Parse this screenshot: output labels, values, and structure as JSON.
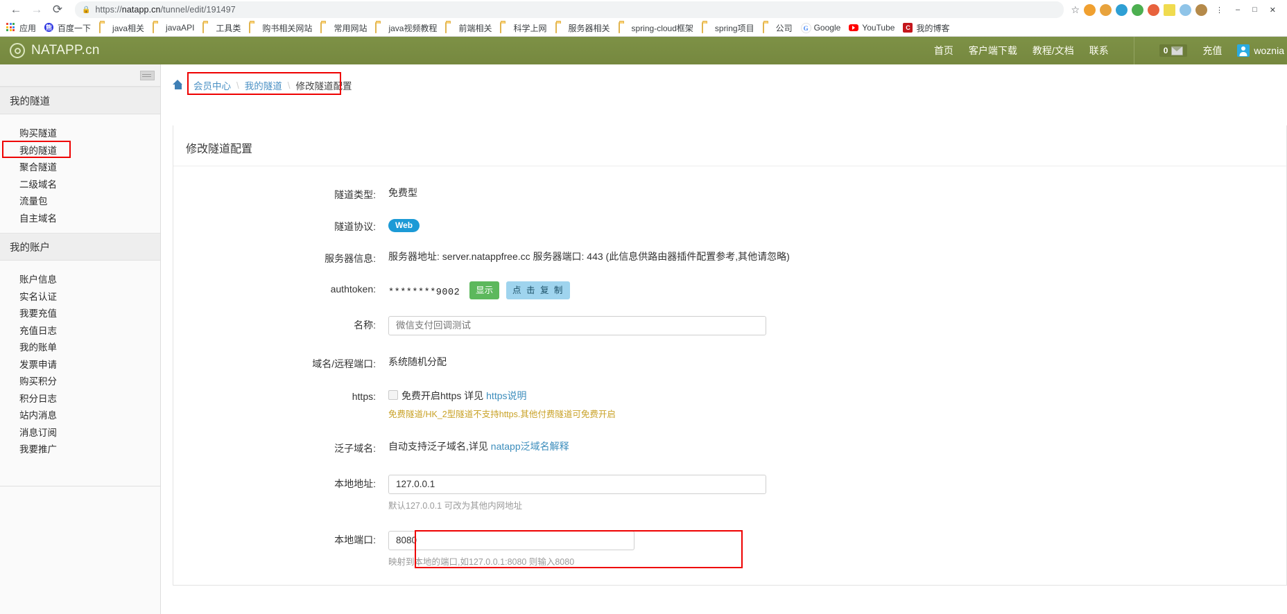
{
  "browser": {
    "nav": {
      "back": "←",
      "forward": "→",
      "reload": "⟳"
    },
    "url_secure_text": "https://",
    "url_host": "natapp.cn",
    "url_path": "/tunnel/edit/191497",
    "url_full": "https://natapp.cn/tunnel/edit/191497",
    "lock_icon": "lock-icon",
    "star_icon": "bookmark-star-icon",
    "bookmarks": [
      {
        "label": "应用",
        "icon": "apps-grid-icon"
      },
      {
        "label": "百度一下",
        "icon": "baidu-icon"
      },
      {
        "label": "java相关",
        "icon": "folder-icon"
      },
      {
        "label": "javaAPI",
        "icon": "folder-icon"
      },
      {
        "label": "工具类",
        "icon": "folder-icon"
      },
      {
        "label": "购书相关网站",
        "icon": "folder-icon"
      },
      {
        "label": "常用网站",
        "icon": "folder-icon"
      },
      {
        "label": "java视频教程",
        "icon": "folder-icon"
      },
      {
        "label": "前端相关",
        "icon": "folder-icon"
      },
      {
        "label": "科学上网",
        "icon": "folder-icon"
      },
      {
        "label": "服务器相关",
        "icon": "folder-icon"
      },
      {
        "label": "spring-cloud框架",
        "icon": "folder-icon"
      },
      {
        "label": "spring项目",
        "icon": "folder-icon"
      },
      {
        "label": "公司",
        "icon": "folder-icon"
      },
      {
        "label": "Google",
        "icon": "google-icon"
      },
      {
        "label": "YouTube",
        "icon": "youtube-icon"
      },
      {
        "label": "我的博客",
        "icon": "csdn-icon"
      }
    ]
  },
  "header": {
    "brand": "NATAPP.cn",
    "nav": [
      {
        "label": "首页"
      },
      {
        "label": "客户端下载"
      },
      {
        "label": "教程/文档"
      },
      {
        "label": "联系"
      }
    ],
    "message_count": "0",
    "recharge_label": "充值",
    "username": "woznia"
  },
  "sidebar": {
    "groups": [
      {
        "title": "我的隧道",
        "items": [
          {
            "label": "购买隧道",
            "highlighted": false
          },
          {
            "label": "我的隧道",
            "highlighted": true
          },
          {
            "label": "聚合隧道",
            "highlighted": false
          },
          {
            "label": "二级域名",
            "highlighted": false
          },
          {
            "label": "流量包",
            "highlighted": false
          },
          {
            "label": "自主域名",
            "highlighted": false
          }
        ]
      },
      {
        "title": "我的账户",
        "items": [
          {
            "label": "账户信息",
            "highlighted": false
          },
          {
            "label": "实名认证",
            "highlighted": false
          },
          {
            "label": "我要充值",
            "highlighted": false
          },
          {
            "label": "充值日志",
            "highlighted": false
          },
          {
            "label": "我的账单",
            "highlighted": false
          },
          {
            "label": "发票申请",
            "highlighted": false
          },
          {
            "label": "购买积分",
            "highlighted": false
          },
          {
            "label": "积分日志",
            "highlighted": false
          },
          {
            "label": "站内消息",
            "highlighted": false
          },
          {
            "label": "消息订阅",
            "highlighted": false
          },
          {
            "label": "我要推广",
            "highlighted": false
          }
        ]
      }
    ]
  },
  "breadcrumb": {
    "home_icon": "home-icon",
    "items": [
      {
        "label": "会员中心",
        "link": true
      },
      {
        "label": "我的隧道",
        "link": true
      },
      {
        "label": "修改隧道配置",
        "link": false
      }
    ],
    "separator": "\\"
  },
  "panel": {
    "title": "修改隧道配置",
    "fields": {
      "tunnel_type": {
        "label": "隧道类型:",
        "value": "免费型"
      },
      "tunnel_protocol": {
        "label": "隧道协议:",
        "badge": "Web"
      },
      "server_info": {
        "label": "服务器信息:",
        "value": "服务器地址: server.natappfree.cc 服务器端口: 443 (此信息供路由器插件配置参考,其他请忽略)"
      },
      "authtoken": {
        "label": "authtoken:",
        "value": "********9002",
        "show_button": "显示",
        "copy_button": "点 击 复 制"
      },
      "name": {
        "label": "名称:",
        "value": "微信支付回调测试"
      },
      "domain_remote_port": {
        "label": "域名/远程端口:",
        "value": "系统随机分配"
      },
      "https": {
        "label": "https:",
        "checkbox_checked": false,
        "text": "免费开启https 详见",
        "link": "https说明",
        "hint": "免费隧道/HK_2型隧道不支持https.其他付费隧道可免费开启"
      },
      "wildcard": {
        "label": "泛子域名:",
        "text": "自动支持泛子域名,详见",
        "link": "natapp泛域名解释"
      },
      "local_address": {
        "label": "本地地址:",
        "value": "127.0.0.1",
        "hint": "默认127.0.0.1 可改为其他内网地址"
      },
      "local_port": {
        "label": "本地端口:",
        "value": "8080",
        "hint": "映射到本地的端口,如127.0.0.1:8080 则输入8080",
        "highlighted": true
      }
    }
  },
  "colors": {
    "brand_green": "#7d9146",
    "highlight_red": "#ee0000",
    "link_blue": "#3c8dbc",
    "badge_blue": "#1c9ad6",
    "show_green": "#5cb85c",
    "copy_blue": "#9fd4ee"
  }
}
